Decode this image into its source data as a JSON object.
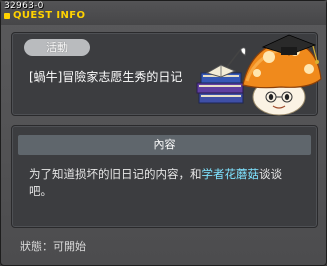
{
  "window": {
    "quest_id": "32963-0",
    "title": "QUEST INFO"
  },
  "quest": {
    "category_label": "活動",
    "name": "[蝸牛]冒險家志愿生秀的日记"
  },
  "content": {
    "header": "內容",
    "text_before": "为了知道损坏的旧日记的内容，和",
    "npc_name": "学者花蘑菇",
    "text_after": "谈谈吧。"
  },
  "status": {
    "text": "狀態：可開始"
  },
  "colors": {
    "title_accent": "#ffd200",
    "npc_highlight": "#7fe3ff"
  },
  "icons": [
    "mushroom-scholar-icon",
    "book-stack-icon"
  ]
}
